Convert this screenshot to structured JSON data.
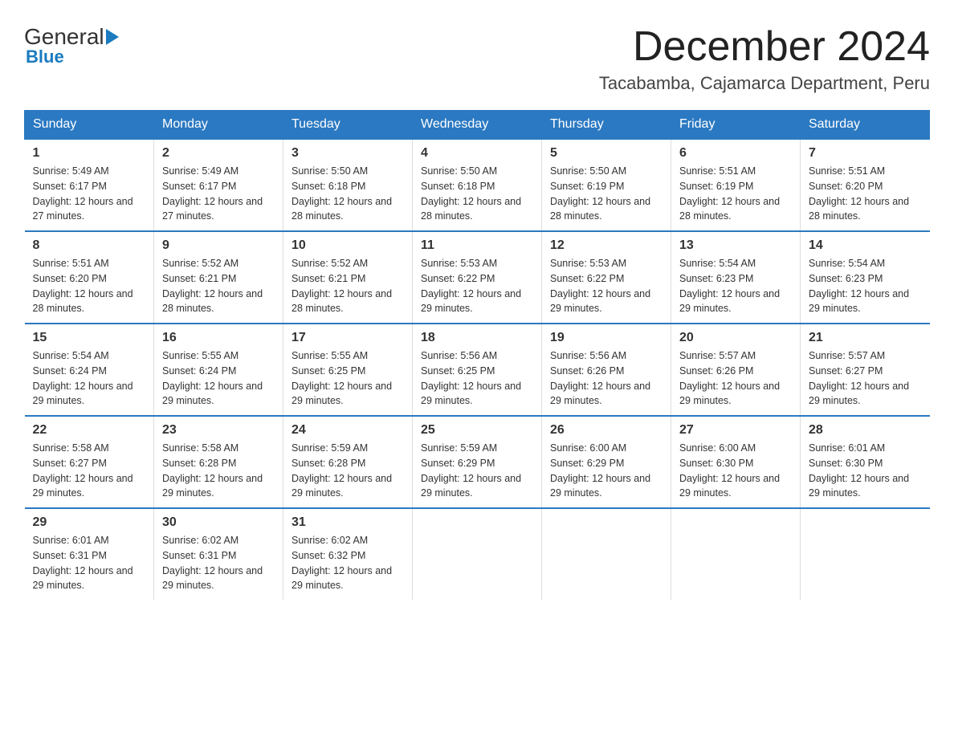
{
  "logo": {
    "text_general": "General",
    "triangle": "",
    "text_blue": "Blue"
  },
  "header": {
    "title": "December 2024",
    "subtitle": "Tacabamba, Cajamarca Department, Peru"
  },
  "days_of_week": [
    "Sunday",
    "Monday",
    "Tuesday",
    "Wednesday",
    "Thursday",
    "Friday",
    "Saturday"
  ],
  "weeks": [
    [
      {
        "day": "1",
        "sunrise": "5:49 AM",
        "sunset": "6:17 PM",
        "daylight": "12 hours and 27 minutes."
      },
      {
        "day": "2",
        "sunrise": "5:49 AM",
        "sunset": "6:17 PM",
        "daylight": "12 hours and 27 minutes."
      },
      {
        "day": "3",
        "sunrise": "5:50 AM",
        "sunset": "6:18 PM",
        "daylight": "12 hours and 28 minutes."
      },
      {
        "day": "4",
        "sunrise": "5:50 AM",
        "sunset": "6:18 PM",
        "daylight": "12 hours and 28 minutes."
      },
      {
        "day": "5",
        "sunrise": "5:50 AM",
        "sunset": "6:19 PM",
        "daylight": "12 hours and 28 minutes."
      },
      {
        "day": "6",
        "sunrise": "5:51 AM",
        "sunset": "6:19 PM",
        "daylight": "12 hours and 28 minutes."
      },
      {
        "day": "7",
        "sunrise": "5:51 AM",
        "sunset": "6:20 PM",
        "daylight": "12 hours and 28 minutes."
      }
    ],
    [
      {
        "day": "8",
        "sunrise": "5:51 AM",
        "sunset": "6:20 PM",
        "daylight": "12 hours and 28 minutes."
      },
      {
        "day": "9",
        "sunrise": "5:52 AM",
        "sunset": "6:21 PM",
        "daylight": "12 hours and 28 minutes."
      },
      {
        "day": "10",
        "sunrise": "5:52 AM",
        "sunset": "6:21 PM",
        "daylight": "12 hours and 28 minutes."
      },
      {
        "day": "11",
        "sunrise": "5:53 AM",
        "sunset": "6:22 PM",
        "daylight": "12 hours and 29 minutes."
      },
      {
        "day": "12",
        "sunrise": "5:53 AM",
        "sunset": "6:22 PM",
        "daylight": "12 hours and 29 minutes."
      },
      {
        "day": "13",
        "sunrise": "5:54 AM",
        "sunset": "6:23 PM",
        "daylight": "12 hours and 29 minutes."
      },
      {
        "day": "14",
        "sunrise": "5:54 AM",
        "sunset": "6:23 PM",
        "daylight": "12 hours and 29 minutes."
      }
    ],
    [
      {
        "day": "15",
        "sunrise": "5:54 AM",
        "sunset": "6:24 PM",
        "daylight": "12 hours and 29 minutes."
      },
      {
        "day": "16",
        "sunrise": "5:55 AM",
        "sunset": "6:24 PM",
        "daylight": "12 hours and 29 minutes."
      },
      {
        "day": "17",
        "sunrise": "5:55 AM",
        "sunset": "6:25 PM",
        "daylight": "12 hours and 29 minutes."
      },
      {
        "day": "18",
        "sunrise": "5:56 AM",
        "sunset": "6:25 PM",
        "daylight": "12 hours and 29 minutes."
      },
      {
        "day": "19",
        "sunrise": "5:56 AM",
        "sunset": "6:26 PM",
        "daylight": "12 hours and 29 minutes."
      },
      {
        "day": "20",
        "sunrise": "5:57 AM",
        "sunset": "6:26 PM",
        "daylight": "12 hours and 29 minutes."
      },
      {
        "day": "21",
        "sunrise": "5:57 AM",
        "sunset": "6:27 PM",
        "daylight": "12 hours and 29 minutes."
      }
    ],
    [
      {
        "day": "22",
        "sunrise": "5:58 AM",
        "sunset": "6:27 PM",
        "daylight": "12 hours and 29 minutes."
      },
      {
        "day": "23",
        "sunrise": "5:58 AM",
        "sunset": "6:28 PM",
        "daylight": "12 hours and 29 minutes."
      },
      {
        "day": "24",
        "sunrise": "5:59 AM",
        "sunset": "6:28 PM",
        "daylight": "12 hours and 29 minutes."
      },
      {
        "day": "25",
        "sunrise": "5:59 AM",
        "sunset": "6:29 PM",
        "daylight": "12 hours and 29 minutes."
      },
      {
        "day": "26",
        "sunrise": "6:00 AM",
        "sunset": "6:29 PM",
        "daylight": "12 hours and 29 minutes."
      },
      {
        "day": "27",
        "sunrise": "6:00 AM",
        "sunset": "6:30 PM",
        "daylight": "12 hours and 29 minutes."
      },
      {
        "day": "28",
        "sunrise": "6:01 AM",
        "sunset": "6:30 PM",
        "daylight": "12 hours and 29 minutes."
      }
    ],
    [
      {
        "day": "29",
        "sunrise": "6:01 AM",
        "sunset": "6:31 PM",
        "daylight": "12 hours and 29 minutes."
      },
      {
        "day": "30",
        "sunrise": "6:02 AM",
        "sunset": "6:31 PM",
        "daylight": "12 hours and 29 minutes."
      },
      {
        "day": "31",
        "sunrise": "6:02 AM",
        "sunset": "6:32 PM",
        "daylight": "12 hours and 29 minutes."
      },
      null,
      null,
      null,
      null
    ]
  ]
}
